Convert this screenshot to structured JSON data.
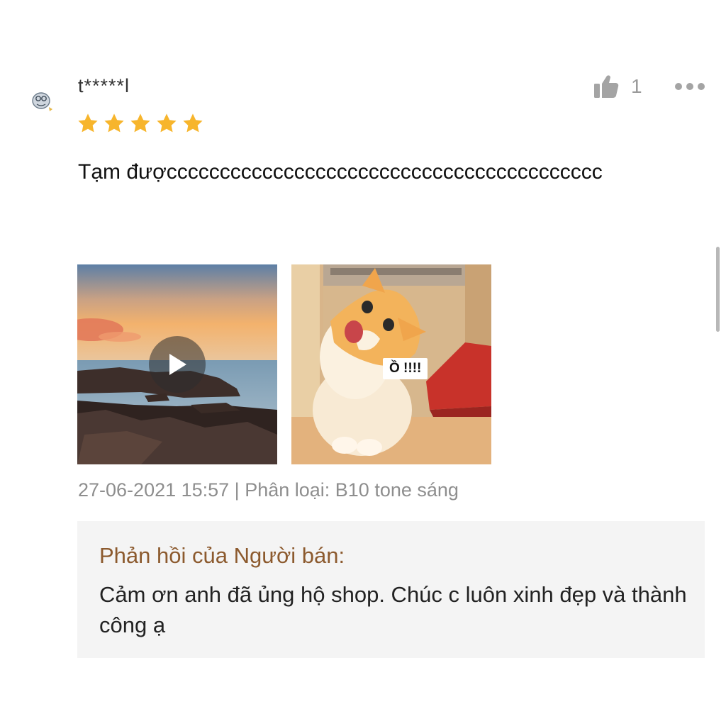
{
  "review": {
    "username": "t*****l",
    "rating": 5,
    "like_count": "1",
    "text": "Tạm đượccccccccccccccccccccccccccccccccccccccccc",
    "media": [
      {
        "kind": "video",
        "icon": "play-icon"
      },
      {
        "kind": "image",
        "overlay_text": "Ồ !!!!"
      }
    ],
    "meta": "27-06-2021 15:57 | Phân loại: B10 tone sáng"
  },
  "seller_reply": {
    "title": "Phản hồi của Người bán:",
    "text": "Cảm ơn anh đã ủng hộ shop. Chúc c luôn xinh đẹp và thành công ạ"
  },
  "colors": {
    "star": "#f7b52c",
    "seller_title": "#8c5a2e",
    "meta": "#8e8e8e",
    "icon_gray": "#a4a4a4"
  },
  "icons": [
    "avatar-icon",
    "star-icon",
    "thumbs-up-icon",
    "more-options-icon",
    "play-icon"
  ]
}
